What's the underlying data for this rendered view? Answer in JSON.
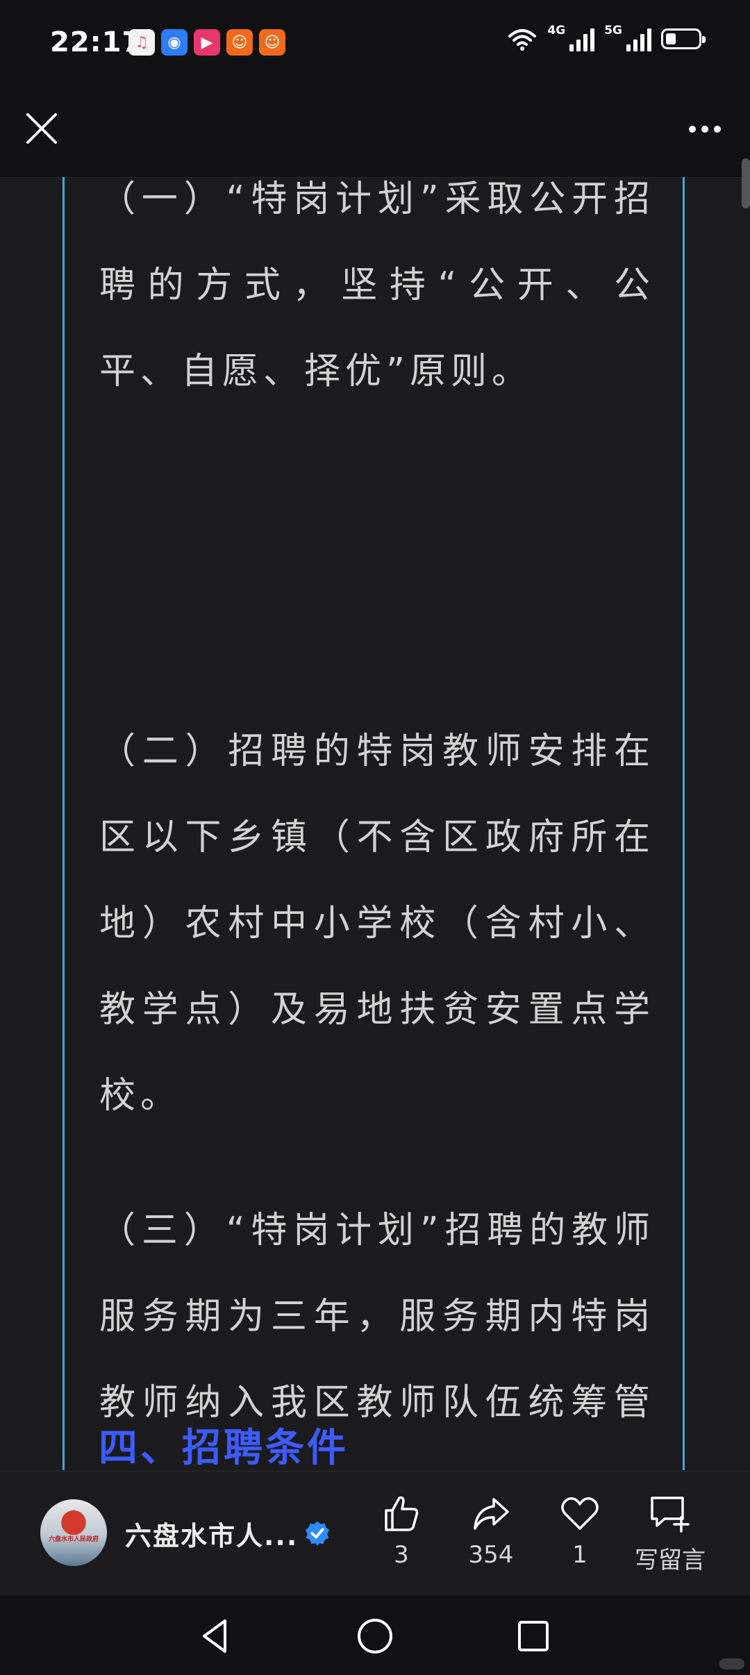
{
  "status_bar": {
    "time": "22:17",
    "network_1": "4G",
    "network_2": "5G",
    "battery_level": 0.3,
    "notification_icons": [
      "music-app-icon",
      "browser-app-icon",
      "video-app-icon",
      "news-app-icon",
      "news-app-icon-2"
    ]
  },
  "navbar": {
    "close_icon": "close-icon",
    "more_icon": "more-icon"
  },
  "article": {
    "paragraphs": [
      "（一）“特岗计划”采取公开招聘的方式，坚持“公开、公平、自愿、择优”原则。",
      "（二）招聘的特岗教师安排在区以下乡镇（不含区政府所在地）农村中小学校（含村小、教学点）及易地扶贫安置点学校。",
      "（三）“特岗计划”招聘的教师服务期为三年，服务期内特岗教师纳入我区教师队伍统筹管理。"
    ],
    "section_heading": "四、招聘条件"
  },
  "action_bar": {
    "account_name": "六盘水市人...",
    "avatar_text": "六盘水市人民政府",
    "like_count": "3",
    "share_count": "354",
    "favorite_count": "1",
    "comment_label": "写留言"
  },
  "colors": {
    "background": "#1b1b1d",
    "frame_border": "#4aa3d6",
    "heading": "#3d5cff",
    "verified": "#2f8cff"
  }
}
